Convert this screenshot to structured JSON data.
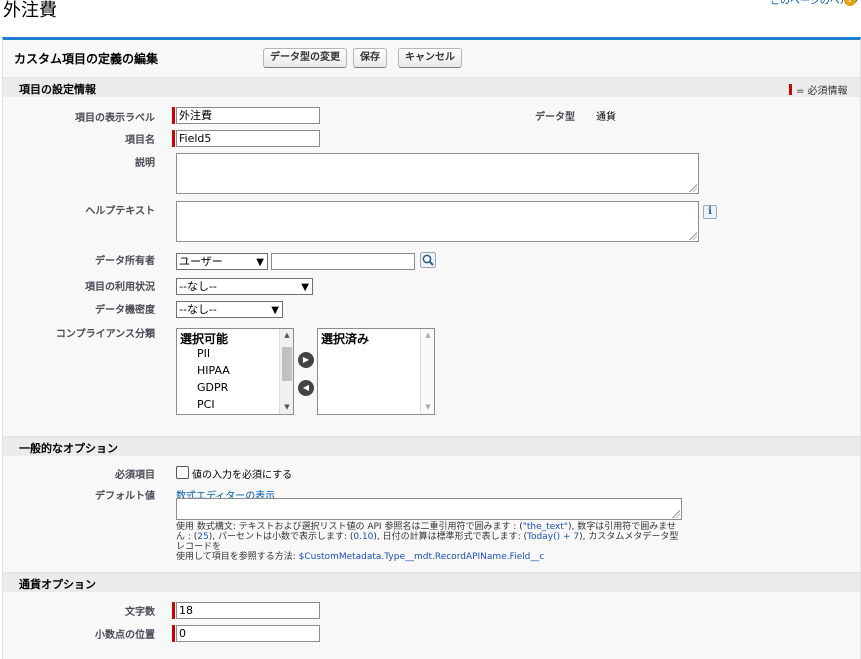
{
  "page": {
    "title": "外注費",
    "help_link": "このページのヘルプ"
  },
  "edit": {
    "title": "カスタム項目の定義の編集",
    "buttons": {
      "change_type": "データ型の変更",
      "save": "保存",
      "cancel": "キャンセル"
    }
  },
  "field_info": {
    "section_title": "項目の設定情報",
    "required_legend": "= 必須情報",
    "display_label": {
      "label": "項目の表示ラベル",
      "value": "外注費"
    },
    "data_type": {
      "label": "データ型",
      "value": "通貨"
    },
    "field_name": {
      "label": "項目名",
      "value": "Field5"
    },
    "description": {
      "label": "説明",
      "value": ""
    },
    "help_text": {
      "label": "ヘルプテキスト",
      "value": ""
    },
    "data_owner": {
      "label": "データ所有者",
      "selected": "ユーザー",
      "value": ""
    },
    "field_usage": {
      "label": "項目の利用状況",
      "selected": "--なし--"
    },
    "data_sensitivity": {
      "label": "データ機密度",
      "selected": "--なし--"
    },
    "compliance": {
      "label": "コンプライアンス分類",
      "available_header": "選択可能",
      "available_options": [
        "PII",
        "HIPAA",
        "GDPR",
        "PCI"
      ],
      "selected_header": "選択済み"
    }
  },
  "general_options": {
    "section_title": "一般的なオプション",
    "required": {
      "label": "必須項目",
      "checkbox_label": "値の入力を必須にする",
      "checked": false
    },
    "default_value": {
      "label": "デフォルト値",
      "formula_editor_link": "数式エディターの表示",
      "value": "",
      "hint_1": "使用 数式構文: テキストおよび選択リスト値の API 参照名は二重引用符で囲みます : (",
      "hint_code_1": "\"the_text\"",
      "hint_2": "), 数字は引用符で囲みませ",
      "hint_3": "ん : (",
      "hint_code_2": "25",
      "hint_4": "), パーセントは小数で表示します: (",
      "hint_code_3": "0.10",
      "hint_5": "), 日付の計算は標準形式で表します: (",
      "hint_code_4": "Today() + 7",
      "hint_6": "), カスタムメタデータ型レコードを",
      "hint_7": "使用して項目を参照する方法: ",
      "hint_code_5": "$CustomMetadata.Type__mdt.RecordAPIName.Field__c"
    }
  },
  "currency_options": {
    "section_title": "通貨オプション",
    "length": {
      "label": "文字数",
      "value": "18"
    },
    "decimal_places": {
      "label": "小数点の位置",
      "value": "0"
    }
  },
  "colors": {
    "accent": "#1f7ed1",
    "required": "#cc0000",
    "link": "#015ba7"
  }
}
